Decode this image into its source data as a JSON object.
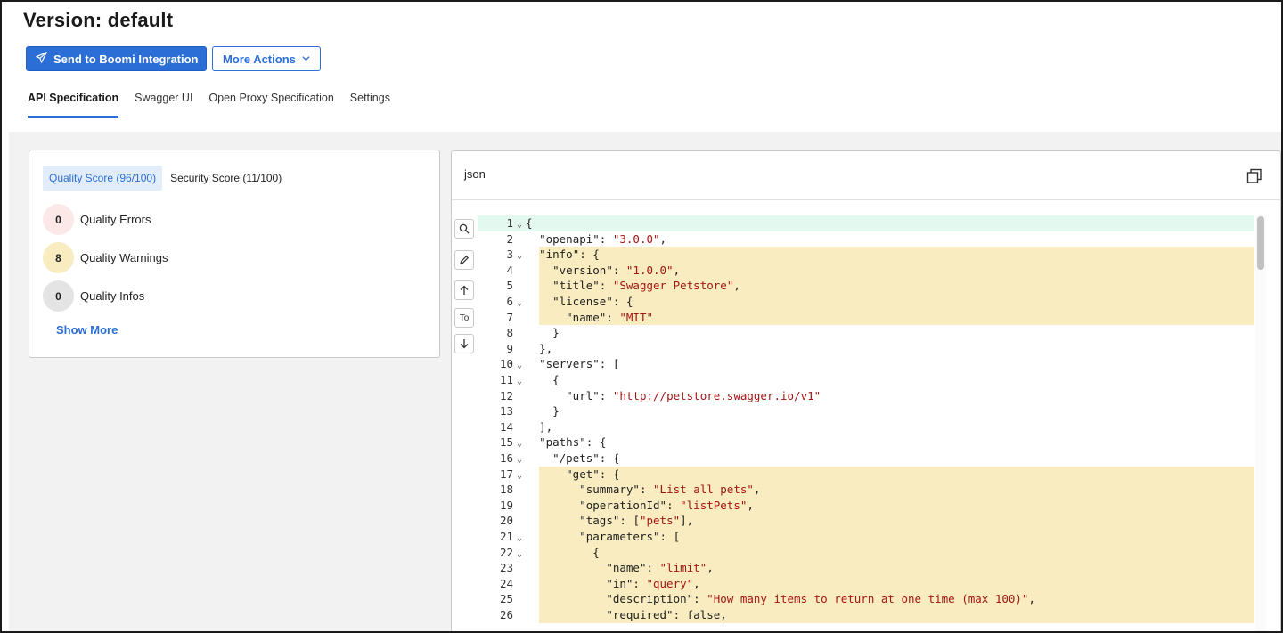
{
  "page": {
    "title": "Version: default"
  },
  "toolbar": {
    "send_label": "Send to Boomi Integration",
    "more_label": "More Actions"
  },
  "tabs": [
    {
      "label": "API Specification",
      "active": true
    },
    {
      "label": "Swagger UI",
      "active": false
    },
    {
      "label": "Open Proxy Specification",
      "active": false
    },
    {
      "label": "Settings",
      "active": false
    }
  ],
  "scores": {
    "tabs": [
      {
        "label": "Quality Score (96/100)",
        "active": true
      },
      {
        "label": "Security Score (11/100)",
        "active": false
      }
    ],
    "items": [
      {
        "count": "0",
        "label": "Quality Errors",
        "color": "#fde8e8"
      },
      {
        "count": "8",
        "label": "Quality Warnings",
        "color": "#f8ecc0"
      },
      {
        "count": "0",
        "label": "Quality Infos",
        "color": "#e4e4e4"
      }
    ],
    "show_more": "Show More"
  },
  "editor": {
    "language": "json",
    "tools": [
      {
        "name": "search-icon"
      },
      {
        "name": "pencil-icon"
      },
      {
        "name": "arrow-up-icon"
      },
      {
        "name": "to-button",
        "label": "To"
      },
      {
        "name": "arrow-down-icon"
      }
    ],
    "lines": [
      {
        "n": "1",
        "fold": true,
        "hl": "green",
        "text": "{"
      },
      {
        "n": "2",
        "fold": false,
        "hl": "",
        "text": "  \"openapi\": \"3.0.0\","
      },
      {
        "n": "3",
        "fold": true,
        "hl": "yellow",
        "text": "  \"info\": {"
      },
      {
        "n": "4",
        "fold": false,
        "hl": "yellow",
        "text": "    \"version\": \"1.0.0\","
      },
      {
        "n": "5",
        "fold": false,
        "hl": "yellow",
        "text": "    \"title\": \"Swagger Petstore\","
      },
      {
        "n": "6",
        "fold": true,
        "hl": "yellow",
        "text": "    \"license\": {"
      },
      {
        "n": "7",
        "fold": false,
        "hl": "yellow",
        "text": "      \"name\": \"MIT\""
      },
      {
        "n": "8",
        "fold": false,
        "hl": "",
        "text": "    }"
      },
      {
        "n": "9",
        "fold": false,
        "hl": "",
        "text": "  },"
      },
      {
        "n": "10",
        "fold": true,
        "hl": "",
        "text": "  \"servers\": ["
      },
      {
        "n": "11",
        "fold": true,
        "hl": "",
        "text": "    {"
      },
      {
        "n": "12",
        "fold": false,
        "hl": "",
        "text": "      \"url\": \"http://petstore.swagger.io/v1\""
      },
      {
        "n": "13",
        "fold": false,
        "hl": "",
        "text": "    }"
      },
      {
        "n": "14",
        "fold": false,
        "hl": "",
        "text": "  ],"
      },
      {
        "n": "15",
        "fold": true,
        "hl": "",
        "text": "  \"paths\": {"
      },
      {
        "n": "16",
        "fold": true,
        "hl": "",
        "text": "    \"/pets\": {"
      },
      {
        "n": "17",
        "fold": true,
        "hl": "yellow",
        "text": "      \"get\": {"
      },
      {
        "n": "18",
        "fold": false,
        "hl": "yellow",
        "text": "        \"summary\": \"List all pets\","
      },
      {
        "n": "19",
        "fold": false,
        "hl": "yellow",
        "text": "        \"operationId\": \"listPets\","
      },
      {
        "n": "20",
        "fold": false,
        "hl": "yellow",
        "text": "        \"tags\": [\"pets\"],"
      },
      {
        "n": "21",
        "fold": true,
        "hl": "yellow",
        "text": "        \"parameters\": ["
      },
      {
        "n": "22",
        "fold": true,
        "hl": "yellow",
        "text": "          {"
      },
      {
        "n": "23",
        "fold": false,
        "hl": "yellow",
        "text": "            \"name\": \"limit\","
      },
      {
        "n": "24",
        "fold": false,
        "hl": "yellow",
        "text": "            \"in\": \"query\","
      },
      {
        "n": "25",
        "fold": false,
        "hl": "yellow",
        "text": "            \"description\": \"How many items to return at one time (max 100)\","
      },
      {
        "n": "26",
        "fold": false,
        "hl": "yellow",
        "text": "            \"required\": false,"
      }
    ]
  },
  "colors": {
    "accent": "#2b6fd6",
    "highlight_yellow": "#f8ecc0",
    "highlight_green": "#e3f8ef",
    "string": "#a31515",
    "keyword": "#0000cc"
  }
}
